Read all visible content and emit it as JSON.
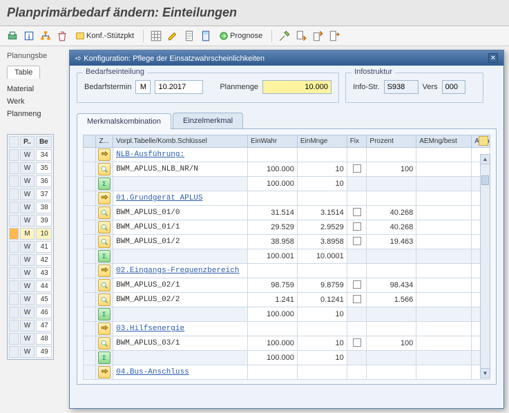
{
  "page": {
    "title": "Planprimärbedarf ändern: Einteilungen"
  },
  "toolbar": {
    "konf_label": "Konf.-Stützpkt",
    "prognose_label": "Prognose"
  },
  "background": {
    "planungsbe_label": "Planungsbe",
    "table_tab": "Table",
    "side_labels": {
      "material": "Material",
      "werk": "Werk",
      "planmeng": "Planmeng"
    },
    "mini_header": {
      "p": "P..",
      "be": "Be"
    },
    "mini_rows": [
      {
        "p": "W",
        "be": "34"
      },
      {
        "p": "W",
        "be": "35"
      },
      {
        "p": "W",
        "be": "36"
      },
      {
        "p": "W",
        "be": "37"
      },
      {
        "p": "W",
        "be": "38"
      },
      {
        "p": "W",
        "be": "39"
      },
      {
        "p": "M",
        "be": "10",
        "sel": true
      },
      {
        "p": "W",
        "be": "41"
      },
      {
        "p": "W",
        "be": "42"
      },
      {
        "p": "W",
        "be": "43"
      },
      {
        "p": "W",
        "be": "44"
      },
      {
        "p": "W",
        "be": "45"
      },
      {
        "p": "W",
        "be": "46"
      },
      {
        "p": "W",
        "be": "47"
      },
      {
        "p": "W",
        "be": "48"
      },
      {
        "p": "W",
        "be": "49"
      }
    ]
  },
  "dialog": {
    "title": "Konfiguration: Pflege der Einsatzwahrscheinlichkeiten",
    "box1_title": "Bedarfseinteilung",
    "box2_title": "Infostruktur",
    "bedarfstermin_label": "Bedarfstermin",
    "bedarfstermin_m": "M",
    "bedarfstermin_val": "10.2017",
    "planmenge_label": "Planmenge",
    "planmenge_val": "10.000",
    "infostr_label": "Info-Str.",
    "infostr_val": "S938",
    "vers_label": "Vers",
    "vers_val": "000",
    "tab1": "Merkmalskombination",
    "tab2": "Einzelmerkmal",
    "columns": {
      "z": "Z...",
      "key": "Vorpl.Tabelle/Komb.Schlüssel",
      "einwahr": "EinWahr",
      "einmnge": "EinMnge",
      "fix": "Fix",
      "prozent": "Prozent",
      "aemng": "AEMng/best",
      "aein": "AEin"
    },
    "rows": [
      {
        "type": "head",
        "key": "NLB-Ausführung:"
      },
      {
        "type": "data",
        "key": "BWM_APLUS_NLB_NR/N",
        "ew": "100.000",
        "em": "10",
        "fix": true,
        "pr": "100"
      },
      {
        "type": "sum",
        "ew": "100.000",
        "em": "10"
      },
      {
        "type": "head",
        "key": "01.Grundgerät APLUS"
      },
      {
        "type": "data",
        "key": "BWM_APLUS_01/0",
        "ew": "31.514",
        "em": "3.1514",
        "fix": true,
        "pr": "40.268"
      },
      {
        "type": "data",
        "key": "BWM_APLUS_01/1",
        "ew": "29.529",
        "em": "2.9529",
        "fix": true,
        "pr": "40.268"
      },
      {
        "type": "data",
        "key": "BWM_APLUS_01/2",
        "ew": "38.958",
        "em": "3.8958",
        "fix": true,
        "pr": "19.463"
      },
      {
        "type": "sum",
        "ew": "100.001",
        "em": "10.0001"
      },
      {
        "type": "head",
        "key": "02.Eingangs-Frequenzbereich"
      },
      {
        "type": "data",
        "key": "BWM_APLUS_02/1",
        "ew": "98.759",
        "em": "9.8759",
        "fix": true,
        "pr": "98.434"
      },
      {
        "type": "data",
        "key": "BWM_APLUS_02/2",
        "ew": "1.241",
        "em": "0.1241",
        "fix": true,
        "pr": "1.566"
      },
      {
        "type": "sum",
        "ew": "100.000",
        "em": "10"
      },
      {
        "type": "head",
        "key": "03.Hilfsenergie"
      },
      {
        "type": "data",
        "key": "BWM_APLUS_03/1",
        "ew": "100.000",
        "em": "10",
        "fix": true,
        "pr": "100"
      },
      {
        "type": "sum",
        "ew": "100.000",
        "em": "10"
      },
      {
        "type": "head",
        "key": "04.Bus-Anschluss"
      }
    ]
  },
  "icons": {
    "title_prefix": "➪"
  }
}
